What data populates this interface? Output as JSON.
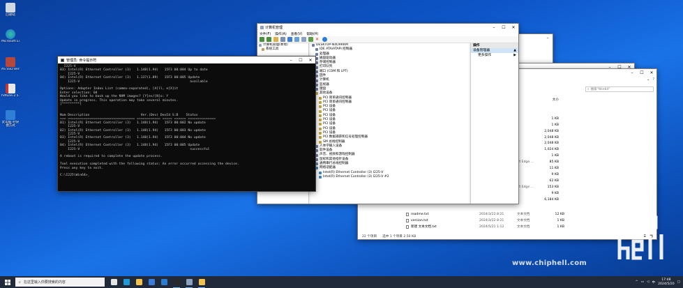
{
  "desktop": {
    "icons": [
      {
        "label": "回收站",
        "color": "#cfd8e3"
      },
      {
        "label": "Microsoft Edge",
        "color": "#1b9de2"
      },
      {
        "label": "AS SSD Benc...",
        "color": "#b5473c"
      },
      {
        "label": "hdtune.2.5...",
        "color": "#c4372e"
      },
      {
        "label": "此电脑 的快捷方式",
        "color": "#2f7fd6"
      }
    ]
  },
  "cmd": {
    "title": "管理员: 命令提示符",
    "lines": [
      "  I225-V",
      "03) Intel(R) Ethernet Controller (3)   1.148(1.94)   15F3 00:004 Up to date",
      "    I225-V",
      "04) Intel(R) Ethernet Controller (3)   1.137(1.89)   15F3 00:005 Update",
      "    I225-V                                                        available",
      "",
      "Options: Adapter Index List (comma-separated), [A]ll, e[X]it",
      "Enter selection: 04",
      "Would you like to back up the NVM images? [Y]es/[N]o: Y",
      "Update in progress. This operation may take several minutes.",
      "[*********]",
      "",
      "",
      "Num Description                          Ver.(Dev) DevId S:B    Status",
      "=== ================================== ============ ===== ====== ==============",
      "01) Intel(R) Ethernet Controller (3)   1.148(1.94)   15F3 00:002 No update",
      "    I225-V",
      "02) Intel(R) Ethernet Controller (3)   1.148(1.94)   15F3 00:003 No update",
      "    I225-V",
      "03) Intel(R) Ethernet Controller (3)   1.148(1.94)   15F3 00:004 No update",
      "    I225-V",
      "04) Intel(R) Ethernet Controller (3)   1.148(1.94)   15F3 00:005 Update",
      "    I225-V                                                        successful",
      "",
      "A reboot is required to complete the update process.",
      "",
      "Tool execution completed with the following status: An error occurred accessing the device.",
      "Press any key to exit.",
      "",
      "C:\\I225\\Win64>_"
    ]
  },
  "mgmt": {
    "title": "计算机管理",
    "menu": [
      "文件(F)",
      "操作(A)",
      "查看(V)",
      "帮助(H)"
    ],
    "left_tree": [
      "计算机管理(本地)",
      "系统工具"
    ],
    "device_root": "DESKTOP-N4O9RKM",
    "devices": [
      {
        "label": "IDE ATA/ATAPI 控制器",
        "indent": 1,
        "color": "#6b7fa6"
      },
      {
        "label": "处理器",
        "indent": 1,
        "color": "#6b7fa6"
      },
      {
        "label": "磁盘驱动器",
        "indent": 1,
        "color": "#6b7fa6"
      },
      {
        "label": "存储控制器",
        "indent": 1,
        "color": "#6b7fa6"
      },
      {
        "label": "打印队列",
        "indent": 1,
        "color": "#6b7fa6"
      },
      {
        "label": "端口 (COM 和 LPT)",
        "indent": 1,
        "color": "#6b7fa6"
      },
      {
        "label": "固件",
        "indent": 1,
        "color": "#6b7fa6"
      },
      {
        "label": "计算机",
        "indent": 1,
        "color": "#6b7fa6"
      },
      {
        "label": "监视器",
        "indent": 1,
        "color": "#6b7fa6"
      },
      {
        "label": "键盘",
        "indent": 1,
        "color": "#6b7fa6"
      },
      {
        "label": "其他设备",
        "indent": 1,
        "color": "#c7a43b"
      },
      {
        "label": "PCI 简单通讯控制器",
        "indent": 2,
        "color": "#c7a43b"
      },
      {
        "label": "PCI 简单通讯控制器",
        "indent": 2,
        "color": "#c7a43b"
      },
      {
        "label": "PCI 设备",
        "indent": 2,
        "color": "#c7a43b"
      },
      {
        "label": "PCI 设备",
        "indent": 2,
        "color": "#c7a43b"
      },
      {
        "label": "PCI 设备",
        "indent": 2,
        "color": "#c7a43b"
      },
      {
        "label": "PCI 设备",
        "indent": 2,
        "color": "#c7a43b"
      },
      {
        "label": "PCI 设备",
        "indent": 2,
        "color": "#c7a43b"
      },
      {
        "label": "PCI 设备",
        "indent": 2,
        "color": "#c7a43b"
      },
      {
        "label": "PCI 设备",
        "indent": 2,
        "color": "#c7a43b"
      },
      {
        "label": "PCI 数据捕获和信号处理控制器",
        "indent": 2,
        "color": "#c7a43b"
      },
      {
        "label": "SM 总线控制器",
        "indent": 2,
        "color": "#c7a43b"
      },
      {
        "label": "人体学输入设备",
        "indent": 1,
        "color": "#6b7fa6"
      },
      {
        "label": "软件设备",
        "indent": 1,
        "color": "#6b7fa6"
      },
      {
        "label": "声音、视频和游戏控制器",
        "indent": 1,
        "color": "#6b7fa6"
      },
      {
        "label": "鼠标和其他指针设备",
        "indent": 1,
        "color": "#6b7fa6"
      },
      {
        "label": "通用串行总线控制器",
        "indent": 1,
        "color": "#6b7fa6"
      },
      {
        "label": "网络适配器",
        "indent": 1,
        "color": "#3c86c6"
      },
      {
        "label": "Intel(R) Ethernet Controller (3) I225-V",
        "indent": 2,
        "color": "#3c86c6"
      },
      {
        "label": "Intel(R) Ethernet Controller (3) I225-V #2",
        "indent": 2,
        "color": "#3c86c6"
      }
    ],
    "actions": {
      "header": "操作",
      "selected": "设备管理器",
      "more": "更多操作"
    }
  },
  "explorer": {
    "search_placeholder": "搜索\"Win64\"",
    "size_header": "大小",
    "size_rows": [
      {
        "type": "",
        "size": ""
      },
      {
        "type": "",
        "size": ""
      },
      {
        "type": "文件",
        "size": "1 KB"
      },
      {
        "type": "文件",
        "size": "1 KB"
      },
      {
        "type": "",
        "size": "2,048 KB"
      },
      {
        "type": "文件",
        "size": "2,048 KB"
      },
      {
        "type": "文件",
        "size": "2,048 KB"
      },
      {
        "type": "文件",
        "size": "1,024 KB"
      },
      {
        "type": "文件",
        "size": "1 KB"
      },
      {
        "type": "rosoft Edge ...",
        "size": "85 KB"
      },
      {
        "type": "",
        "size": "11 KB"
      },
      {
        "type": "文件",
        "size": "9 KB"
      },
      {
        "type": "文件",
        "size": "62 KB"
      },
      {
        "type": "rosoft Edge ...",
        "size": "153 KB"
      },
      {
        "type": "文件",
        "size": "9 KB"
      },
      {
        "type": "",
        "size": "6,184 KB"
      }
    ],
    "files": [
      {
        "name": "readme.txt",
        "date": "2024/3/22 8:21",
        "type": "文本文档",
        "size": "12 KB"
      },
      {
        "name": "version.txt",
        "date": "2024/3/22 8:21",
        "type": "文本文档",
        "size": "1 KB"
      },
      {
        "name": "新建 文本文档.txt",
        "date": "2024/5/21 1:12",
        "type": "文本文档",
        "size": "1 KB"
      }
    ],
    "status": {
      "count": "22 个项目",
      "selected": "选中 1 个项目 2.50 KB"
    }
  },
  "taskbar": {
    "search_placeholder": "在这里输入你要搜索的内容",
    "apps": [
      {
        "name": "task-view",
        "color": "#e6e6e6"
      },
      {
        "name": "edge",
        "color": "#1f9ad6"
      },
      {
        "name": "file-explorer",
        "color": "#f2c14e"
      },
      {
        "name": "store",
        "color": "#3b7dd8"
      },
      {
        "name": "mail",
        "color": "#2b7cd3"
      },
      {
        "name": "cmd",
        "color": "#2a2a2a"
      },
      {
        "name": "computer-management",
        "color": "#8da2c0"
      },
      {
        "name": "explorer-2",
        "color": "#f2c14e"
      }
    ],
    "tray_lang": "中",
    "time": "17:48",
    "date": "2024/5/20"
  },
  "watermark": {
    "url": "www.chiphell.com"
  }
}
